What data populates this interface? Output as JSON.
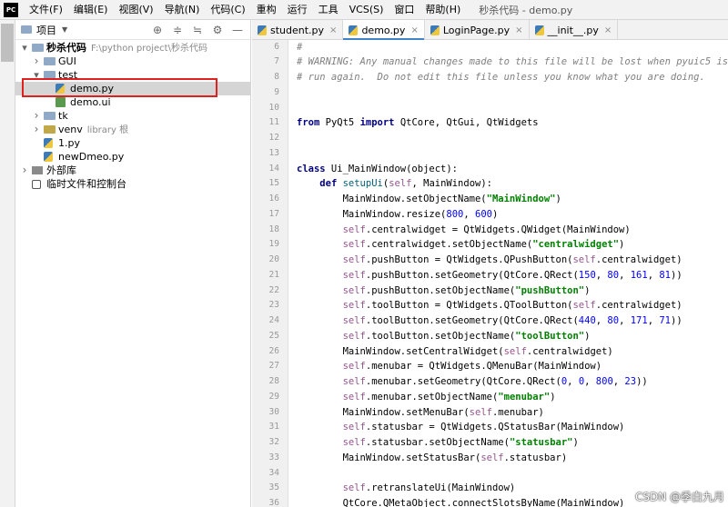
{
  "app": {
    "logo_text": "PC",
    "window_title": "秒杀代码 - demo.py"
  },
  "menu": [
    "文件(F)",
    "编辑(E)",
    "视图(V)",
    "导航(N)",
    "代码(C)",
    "重构",
    "运行",
    "工具",
    "VCS(S)",
    "窗口",
    "帮助(H)"
  ],
  "project_panel": {
    "title": "项目",
    "toolbar_icons": [
      "crosshair-icon",
      "collapse-all-icon",
      "expand-all-icon",
      "gear-icon",
      "hide-icon"
    ],
    "tree": [
      {
        "label": "秒杀代码",
        "suffix": "F:\\python project\\秒杀代码",
        "type": "folder",
        "depth": 0,
        "expanded": true,
        "bold": true
      },
      {
        "label": "GUI",
        "type": "folder",
        "depth": 1,
        "expanded": false
      },
      {
        "label": "test",
        "type": "folder",
        "depth": 1,
        "expanded": true
      },
      {
        "label": "demo.py",
        "type": "py",
        "depth": 2,
        "selected": true
      },
      {
        "label": "demo.ui",
        "type": "ui",
        "depth": 2
      },
      {
        "label": "tk",
        "type": "folder",
        "depth": 1,
        "expanded": false
      },
      {
        "label": "venv",
        "suffix": "library 根",
        "type": "venv",
        "depth": 1,
        "expanded": false
      },
      {
        "label": "1.py",
        "type": "py",
        "depth": 1
      },
      {
        "label": "newDmeo.py",
        "type": "py",
        "depth": 1
      },
      {
        "label": "外部库",
        "type": "lib",
        "depth": 0,
        "expanded": false
      },
      {
        "label": "临时文件和控制台",
        "type": "scratch",
        "depth": 0
      }
    ]
  },
  "tabs": [
    {
      "label": "student.py",
      "active": false
    },
    {
      "label": "demo.py",
      "active": true
    },
    {
      "label": "LoginPage.py",
      "active": false
    },
    {
      "label": "__init__.py",
      "active": false
    }
  ],
  "code": [
    {
      "n": "6",
      "indent": 0,
      "tokens": [
        [
          "#",
          "cm"
        ]
      ]
    },
    {
      "n": "7",
      "indent": 0,
      "tokens": [
        [
          "# WARNING: Any manual changes made to this file will be lost when pyuic5 is",
          "cm"
        ]
      ]
    },
    {
      "n": "8",
      "indent": 0,
      "tokens": [
        [
          "# run again.  Do not edit this file unless you know what you are doing.",
          "cm"
        ]
      ]
    },
    {
      "n": "9",
      "indent": 0,
      "tokens": []
    },
    {
      "n": "10",
      "indent": 0,
      "tokens": []
    },
    {
      "n": "11",
      "indent": 0,
      "tokens": [
        [
          "from",
          "kw"
        ],
        [
          " PyQt5 ",
          "pl"
        ],
        [
          "import",
          "kw"
        ],
        [
          " QtCore, QtGui, QtWidgets",
          "pl"
        ]
      ]
    },
    {
      "n": "12",
      "indent": 0,
      "tokens": []
    },
    {
      "n": "13",
      "indent": 0,
      "tokens": []
    },
    {
      "n": "14",
      "indent": 0,
      "tokens": [
        [
          "class",
          "kw"
        ],
        [
          " Ui_MainWindow(object):",
          "pl"
        ]
      ]
    },
    {
      "n": "15",
      "indent": 1,
      "tokens": [
        [
          "def",
          "kw"
        ],
        [
          " ",
          "pl"
        ],
        [
          "setupUi",
          "fn"
        ],
        [
          "(",
          "pl"
        ],
        [
          "self",
          "sf"
        ],
        [
          ", MainWindow):",
          "pl"
        ]
      ]
    },
    {
      "n": "16",
      "indent": 2,
      "tokens": [
        [
          "MainWindow.setObjectName(",
          "pl"
        ],
        [
          "\"MainWindow\"",
          "st"
        ],
        [
          ")",
          "pl"
        ]
      ]
    },
    {
      "n": "17",
      "indent": 2,
      "tokens": [
        [
          "MainWindow.resize(",
          "pl"
        ],
        [
          "800",
          "nm"
        ],
        [
          ", ",
          "pl"
        ],
        [
          "600",
          "nm"
        ],
        [
          ")",
          "pl"
        ]
      ]
    },
    {
      "n": "18",
      "indent": 2,
      "tokens": [
        [
          "self",
          "sf"
        ],
        [
          ".centralwidget = QtWidgets.QWidget(MainWindow)",
          "pl"
        ]
      ]
    },
    {
      "n": "19",
      "indent": 2,
      "tokens": [
        [
          "self",
          "sf"
        ],
        [
          ".centralwidget.setObjectName(",
          "pl"
        ],
        [
          "\"centralwidget\"",
          "st"
        ],
        [
          ")",
          "pl"
        ]
      ]
    },
    {
      "n": "20",
      "indent": 2,
      "tokens": [
        [
          "self",
          "sf"
        ],
        [
          ".pushButton = QtWidgets.QPushButton(",
          "pl"
        ],
        [
          "self",
          "sf"
        ],
        [
          ".centralwidget)",
          "pl"
        ]
      ]
    },
    {
      "n": "21",
      "indent": 2,
      "tokens": [
        [
          "self",
          "sf"
        ],
        [
          ".pushButton.setGeometry(QtCore.QRect(",
          "pl"
        ],
        [
          "150",
          "nm"
        ],
        [
          ", ",
          "pl"
        ],
        [
          "80",
          "nm"
        ],
        [
          ", ",
          "pl"
        ],
        [
          "161",
          "nm"
        ],
        [
          ", ",
          "pl"
        ],
        [
          "81",
          "nm"
        ],
        [
          "))",
          "pl"
        ]
      ]
    },
    {
      "n": "22",
      "indent": 2,
      "tokens": [
        [
          "self",
          "sf"
        ],
        [
          ".pushButton.setObjectName(",
          "pl"
        ],
        [
          "\"pushButton\"",
          "st"
        ],
        [
          ")",
          "pl"
        ]
      ]
    },
    {
      "n": "23",
      "indent": 2,
      "tokens": [
        [
          "self",
          "sf"
        ],
        [
          ".toolButton = QtWidgets.QToolButton(",
          "pl"
        ],
        [
          "self",
          "sf"
        ],
        [
          ".centralwidget)",
          "pl"
        ]
      ]
    },
    {
      "n": "24",
      "indent": 2,
      "tokens": [
        [
          "self",
          "sf"
        ],
        [
          ".toolButton.setGeometry(QtCore.QRect(",
          "pl"
        ],
        [
          "440",
          "nm"
        ],
        [
          ", ",
          "pl"
        ],
        [
          "80",
          "nm"
        ],
        [
          ", ",
          "pl"
        ],
        [
          "171",
          "nm"
        ],
        [
          ", ",
          "pl"
        ],
        [
          "71",
          "nm"
        ],
        [
          "))",
          "pl"
        ]
      ]
    },
    {
      "n": "25",
      "indent": 2,
      "tokens": [
        [
          "self",
          "sf"
        ],
        [
          ".toolButton.setObjectName(",
          "pl"
        ],
        [
          "\"toolButton\"",
          "st"
        ],
        [
          ")",
          "pl"
        ]
      ]
    },
    {
      "n": "26",
      "indent": 2,
      "tokens": [
        [
          "MainWindow.setCentralWidget(",
          "pl"
        ],
        [
          "self",
          "sf"
        ],
        [
          ".centralwidget)",
          "pl"
        ]
      ]
    },
    {
      "n": "27",
      "indent": 2,
      "tokens": [
        [
          "self",
          "sf"
        ],
        [
          ".menubar = QtWidgets.QMenuBar(MainWindow)",
          "pl"
        ]
      ]
    },
    {
      "n": "28",
      "indent": 2,
      "tokens": [
        [
          "self",
          "sf"
        ],
        [
          ".menubar.setGeometry(QtCore.QRect(",
          "pl"
        ],
        [
          "0",
          "nm"
        ],
        [
          ", ",
          "pl"
        ],
        [
          "0",
          "nm"
        ],
        [
          ", ",
          "pl"
        ],
        [
          "800",
          "nm"
        ],
        [
          ", ",
          "pl"
        ],
        [
          "23",
          "nm"
        ],
        [
          "))",
          "pl"
        ]
      ]
    },
    {
      "n": "29",
      "indent": 2,
      "tokens": [
        [
          "self",
          "sf"
        ],
        [
          ".menubar.setObjectName(",
          "pl"
        ],
        [
          "\"menubar\"",
          "st"
        ],
        [
          ")",
          "pl"
        ]
      ]
    },
    {
      "n": "30",
      "indent": 2,
      "tokens": [
        [
          "MainWindow.setMenuBar(",
          "pl"
        ],
        [
          "self",
          "sf"
        ],
        [
          ".menubar)",
          "pl"
        ]
      ]
    },
    {
      "n": "31",
      "indent": 2,
      "tokens": [
        [
          "self",
          "sf"
        ],
        [
          ".statusbar = QtWidgets.QStatusBar(MainWindow)",
          "pl"
        ]
      ]
    },
    {
      "n": "32",
      "indent": 2,
      "tokens": [
        [
          "self",
          "sf"
        ],
        [
          ".statusbar.setObjectName(",
          "pl"
        ],
        [
          "\"statusbar\"",
          "st"
        ],
        [
          ")",
          "pl"
        ]
      ]
    },
    {
      "n": "33",
      "indent": 2,
      "tokens": [
        [
          "MainWindow.setStatusBar(",
          "pl"
        ],
        [
          "self",
          "sf"
        ],
        [
          ".statusbar)",
          "pl"
        ]
      ]
    },
    {
      "n": "34",
      "indent": 0,
      "tokens": []
    },
    {
      "n": "35",
      "indent": 2,
      "tokens": [
        [
          "self",
          "sf"
        ],
        [
          ".retranslateUi(MainWindow)",
          "pl"
        ]
      ]
    },
    {
      "n": "36",
      "indent": 2,
      "tokens": [
        [
          "QtCore.QMetaObject.connectSlotsByName(MainWindow)",
          "pl"
        ]
      ]
    }
  ],
  "watermark": "CSDN @季白九月"
}
